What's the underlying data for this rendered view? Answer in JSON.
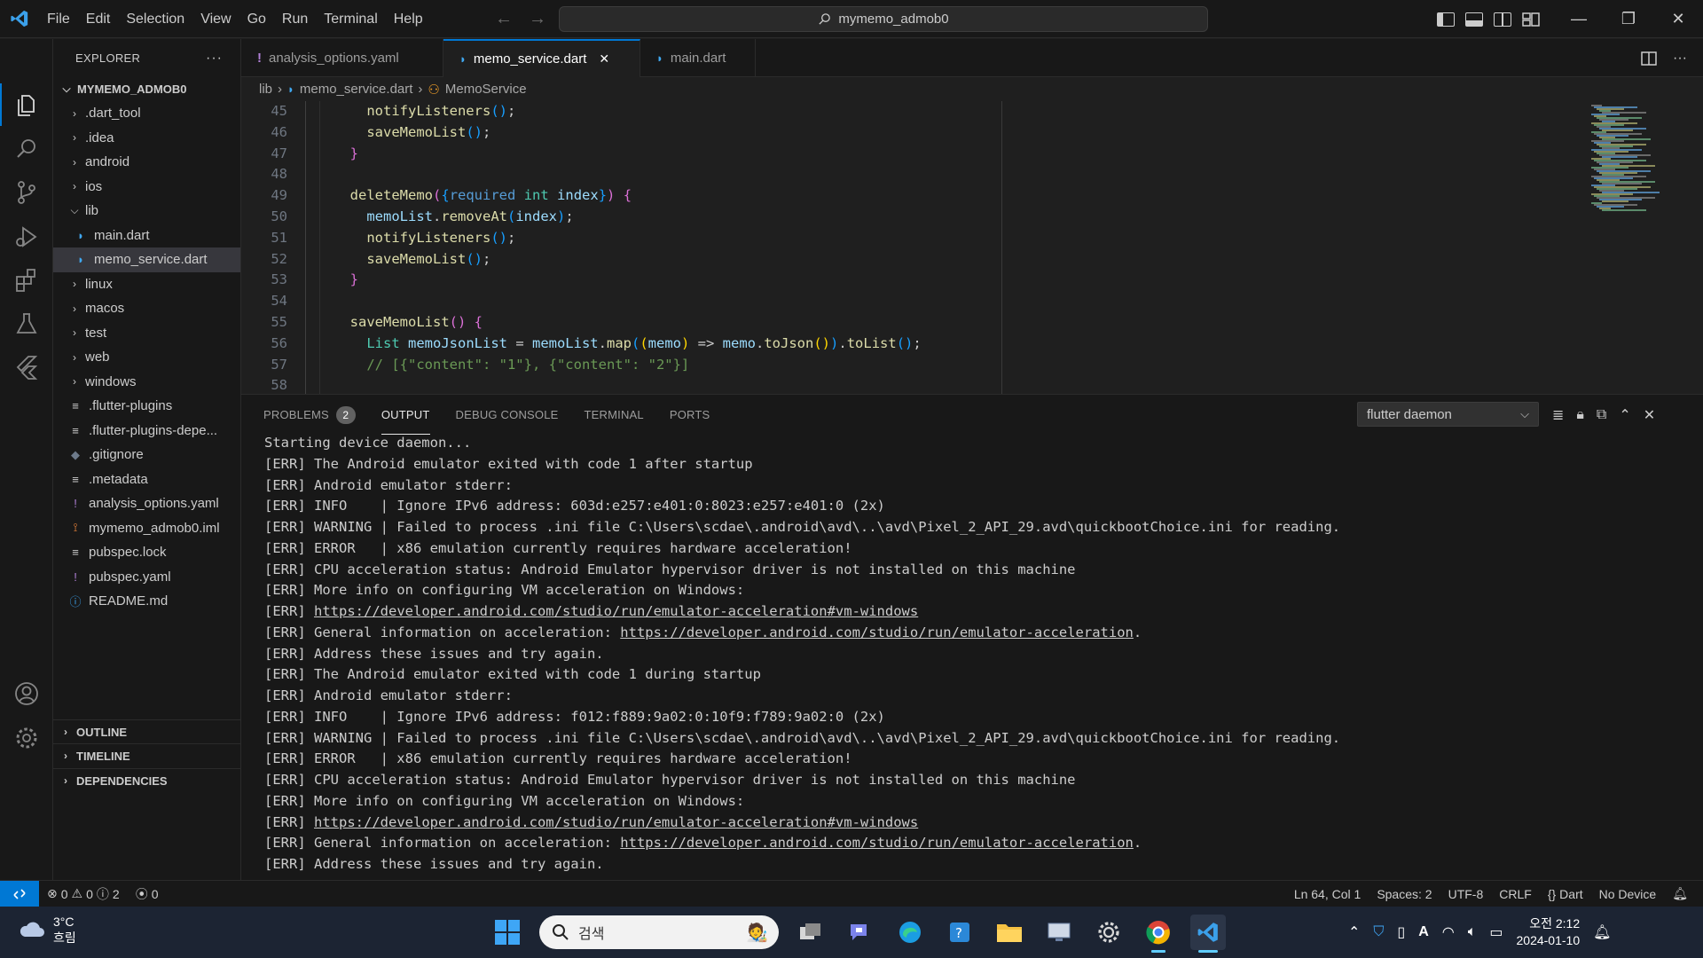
{
  "title_bar": {
    "menu": [
      "File",
      "Edit",
      "Selection",
      "View",
      "Go",
      "Run",
      "Terminal",
      "Help"
    ],
    "search_text": "mymemo_admob0"
  },
  "explorer": {
    "header": "EXPLORER",
    "more": "···",
    "root": "MYMEMO_ADMOB0",
    "items": [
      {
        "label": ".dart_tool",
        "kind": "folder",
        "open": false,
        "depth": 0
      },
      {
        "label": ".idea",
        "kind": "folder",
        "open": false,
        "depth": 0
      },
      {
        "label": "android",
        "kind": "folder",
        "open": false,
        "depth": 0
      },
      {
        "label": "ios",
        "kind": "folder",
        "open": false,
        "depth": 0
      },
      {
        "label": "lib",
        "kind": "folder",
        "open": true,
        "depth": 0
      },
      {
        "label": "main.dart",
        "kind": "dart",
        "depth": 1
      },
      {
        "label": "memo_service.dart",
        "kind": "dart",
        "depth": 1,
        "selected": true
      },
      {
        "label": "linux",
        "kind": "folder",
        "open": false,
        "depth": 0
      },
      {
        "label": "macos",
        "kind": "folder",
        "open": false,
        "depth": 0
      },
      {
        "label": "test",
        "kind": "folder",
        "open": false,
        "depth": 0
      },
      {
        "label": "web",
        "kind": "folder",
        "open": false,
        "depth": 0
      },
      {
        "label": "windows",
        "kind": "folder",
        "open": false,
        "depth": 0
      },
      {
        "label": ".flutter-plugins",
        "kind": "lines",
        "depth": 0
      },
      {
        "label": ".flutter-plugins-depe...",
        "kind": "lines",
        "depth": 0
      },
      {
        "label": ".gitignore",
        "kind": "git",
        "depth": 0
      },
      {
        "label": ".metadata",
        "kind": "lines",
        "depth": 0
      },
      {
        "label": "analysis_options.yaml",
        "kind": "yaml",
        "depth": 0
      },
      {
        "label": "mymemo_admob0.iml",
        "kind": "rss",
        "depth": 0
      },
      {
        "label": "pubspec.lock",
        "kind": "lines",
        "depth": 0
      },
      {
        "label": "pubspec.yaml",
        "kind": "yaml",
        "depth": 0
      },
      {
        "label": "README.md",
        "kind": "info",
        "depth": 0
      }
    ],
    "sections": [
      "OUTLINE",
      "TIMELINE",
      "DEPENDENCIES"
    ]
  },
  "tabs": [
    {
      "label": "analysis_options.yaml",
      "icon": "yaml",
      "active": false
    },
    {
      "label": "memo_service.dart",
      "icon": "dart",
      "active": true,
      "close": "✕"
    },
    {
      "label": "main.dart",
      "icon": "dart",
      "active": false
    }
  ],
  "breadcrumb": {
    "folder": "lib",
    "file": "memo_service.dart",
    "symbol": "MemoService"
  },
  "code_lines": [
    45,
    46,
    47,
    48,
    49,
    50,
    51,
    52,
    53,
    54,
    55,
    56,
    57,
    58
  ],
  "panel": {
    "tabs": [
      "PROBLEMS",
      "OUTPUT",
      "DEBUG CONSOLE",
      "TERMINAL",
      "PORTS"
    ],
    "problems_count": "2",
    "active_tab": "OUTPUT",
    "channel": "flutter daemon",
    "output_lines": [
      "Starting device daemon...",
      "[ERR] The Android emulator exited with code 1 after startup",
      "[ERR] Android emulator stderr:",
      "[ERR] INFO    | Ignore IPv6 address: 603d:e257:e401:0:8023:e257:e401:0 (2x)",
      "[ERR] WARNING | Failed to process .ini file C:\\Users\\scdae\\.android\\avd\\..\\avd\\Pixel_2_API_29.avd\\quickbootChoice.ini for reading.",
      "[ERR] ERROR   | x86 emulation currently requires hardware acceleration!",
      "[ERR] CPU acceleration status: Android Emulator hypervisor driver is not installed on this machine",
      "[ERR] More info on configuring VM acceleration on Windows:",
      "[ERR] |https://developer.android.com/studio/run/emulator-acceleration#vm-windows|",
      "[ERR] General information on acceleration: |https://developer.android.com/studio/run/emulator-acceleration|.",
      "[ERR] Address these issues and try again.",
      "[ERR] The Android emulator exited with code 1 during startup",
      "[ERR] Android emulator stderr:",
      "[ERR] INFO    | Ignore IPv6 address: f012:f889:9a02:0:10f9:f789:9a02:0 (2x)",
      "[ERR] WARNING | Failed to process .ini file C:\\Users\\scdae\\.android\\avd\\..\\avd\\Pixel_2_API_29.avd\\quickbootChoice.ini for reading.",
      "[ERR] ERROR   | x86 emulation currently requires hardware acceleration!",
      "[ERR] CPU acceleration status: Android Emulator hypervisor driver is not installed on this machine",
      "[ERR] More info on configuring VM acceleration on Windows:",
      "[ERR] |https://developer.android.com/studio/run/emulator-acceleration#vm-windows|",
      "[ERR] General information on acceleration: |https://developer.android.com/studio/run/emulator-acceleration|.",
      "[ERR] Address these issues and try again."
    ]
  },
  "status_bar": {
    "errors": "0",
    "warnings": "0",
    "infos": "2",
    "ports": "0",
    "position": "Ln 64, Col 1",
    "spaces": "Spaces: 2",
    "encoding": "UTF-8",
    "eol": "CRLF",
    "language": "Dart",
    "device": "No Device"
  },
  "taskbar": {
    "temperature": "3°C",
    "weather": "흐림",
    "search_placeholder": "검색",
    "time": "오전 2:12",
    "date": "2024-01-10"
  },
  "colors": {
    "accent": "#0078d4",
    "background": "#1f1f1f",
    "sidebar": "#181818",
    "taskbar": "#1c2433"
  }
}
